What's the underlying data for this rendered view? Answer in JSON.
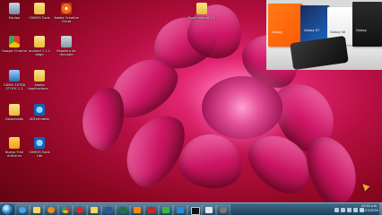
{
  "desktop": {
    "icons": [
      {
        "label": "Equipo",
        "icon": "computer-icon"
      },
      {
        "label": "OXMOS Tools",
        "icon": "folder-icon"
      },
      {
        "label": "Adobe Creative Cloud",
        "icon": "creative-cloud-icon"
      },
      {
        "label": "Google Chrome",
        "icon": "chrome-icon"
      },
      {
        "label": "android 7.1.2 telge",
        "icon": "folder-icon"
      },
      {
        "label": "Papelera de reciclaje",
        "icon": "trash-icon"
      },
      {
        "label": "ODIN3 EXTRA STOCK 1.2",
        "icon": "odin-icon"
      },
      {
        "label": "Adobe Applications...",
        "icon": "folder-icon"
      },
      {
        "label": "Downloads",
        "icon": "folder-icon"
      },
      {
        "label": "SDFormatter",
        "icon": "sdformatter-icon"
      },
      {
        "label": "Nuevo Free Antivirus",
        "icon": "antivirus-icon"
      },
      {
        "label": "OXMOS Tools Lite",
        "icon": "tools-lite-icon"
      },
      {
        "label": "Root android 7.1",
        "icon": "folder-icon"
      }
    ]
  },
  "product_photo": {
    "boxes": [
      {
        "text": "Galaxy"
      },
      {
        "text": "Galaxy S7"
      },
      {
        "text": "Galaxy S6"
      },
      {
        "text": "Galaxy"
      }
    ]
  },
  "taskbar": {
    "apps": [
      {
        "name": "ie-icon"
      },
      {
        "name": "explorer-icon"
      },
      {
        "name": "media-player-icon"
      },
      {
        "name": "chrome-icon"
      },
      {
        "name": "opera-icon"
      },
      {
        "name": "folder-icon"
      },
      {
        "name": "word-icon"
      },
      {
        "name": "excel-icon"
      },
      {
        "name": "vlc-icon"
      },
      {
        "name": "uninstall-icon"
      },
      {
        "name": "green-app-icon"
      },
      {
        "name": "windows-media-icon"
      },
      {
        "name": "cmd-icon"
      },
      {
        "name": "paint-icon"
      },
      {
        "name": "camera-icon"
      }
    ],
    "clock": {
      "time": "10:34 p.m.",
      "date": "21/11/2016"
    }
  },
  "colors": {
    "taskbar": "#1e3e57",
    "wallpaper_accent": "#e0246f"
  }
}
